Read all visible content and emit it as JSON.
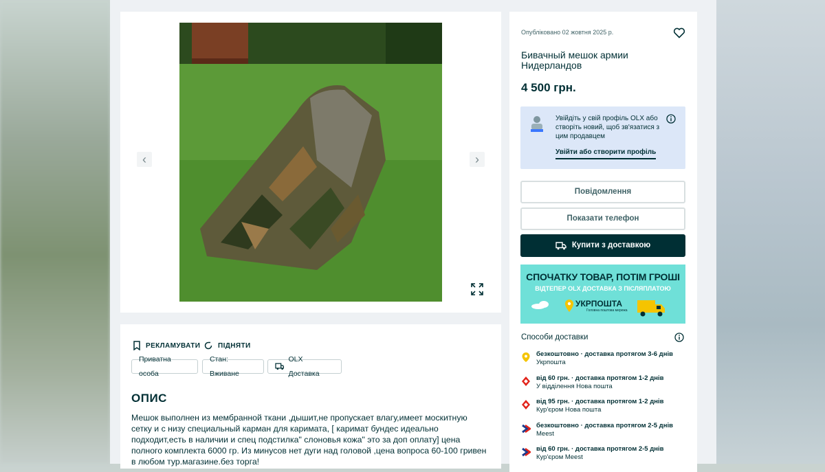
{
  "listing": {
    "published": "Опубліковано 02 жовтня 2025 р.",
    "title": "Бивачный мешок армии Нидерландов",
    "price": "4 500 грн."
  },
  "gallery": {
    "prev_icon": "chevron-left-icon",
    "next_icon": "chevron-right-icon",
    "expand_icon": "expand-icon"
  },
  "actions": {
    "promote": "РЕКЛАМУВАТИ",
    "raise": "ПІДНЯТИ"
  },
  "tags": [
    "Приватна особа",
    "Стан: Вживане",
    "OLX Доставка"
  ],
  "description": {
    "title": "ОПИС",
    "text": "Мешок выполнен из мембранной ткани ,дышит,не пропускает влагу,имеет москитную сетку и с низу специальный карман для каримата, [ каримат бундес идеально подходит,есть в наличии и спец подстилка\" слоновья кожа\" это за доп оплату] цена полного комплекта 6000 гр. Из минусов нет дуги над головой ,цена вопроса 60-100 гривен в любом тур.магазине.без торга!"
  },
  "login_box": {
    "text": "Увійдіть у свій профіль OLX або створіть новий, щоб зв'язатися з цим продавцем",
    "link": "Увійти або створити профіль"
  },
  "buttons": {
    "message": "Повідомлення",
    "show_phone": "Показати телефон",
    "buy_delivery": "Купити з доставкою"
  },
  "banner": {
    "headline": "СПОЧАТКУ ТОВАР, ПОТІМ ГРОШІ",
    "subline": "ВІДТЕПЕР OLX ДОСТАВКА З ПІСЛЯПЛАТОЮ",
    "logo": "УКРПОШТА",
    "logo_sub": "Головна поштова мережа"
  },
  "delivery": {
    "title": "Способи доставки",
    "items": [
      {
        "main": "безкоштовно · доставка протягом 3-6 днів",
        "sub": "Укрпошта",
        "icon": "ukrposhta-icon",
        "color": "#f5c400"
      },
      {
        "main": "від 60 грн. · доставка протягом 1-2 днів",
        "sub": "У відділення Нова пошта",
        "icon": "nova-poshta-icon",
        "color": "#e2231a"
      },
      {
        "main": "від 95 грн. · доставка протягом 1-2 днів",
        "sub": "Кур'єром Нова пошта",
        "icon": "nova-poshta-icon",
        "color": "#e2231a"
      },
      {
        "main": "безкоштовно · доставка протягом 2-5 днів",
        "sub": "Meest",
        "icon": "meest-icon",
        "color": "#e2231a"
      },
      {
        "main": "від 60 грн. · доставка протягом 2-5 днів",
        "sub": "Кур'єром Meest",
        "icon": "meest-icon",
        "color": "#e2231a"
      }
    ]
  }
}
